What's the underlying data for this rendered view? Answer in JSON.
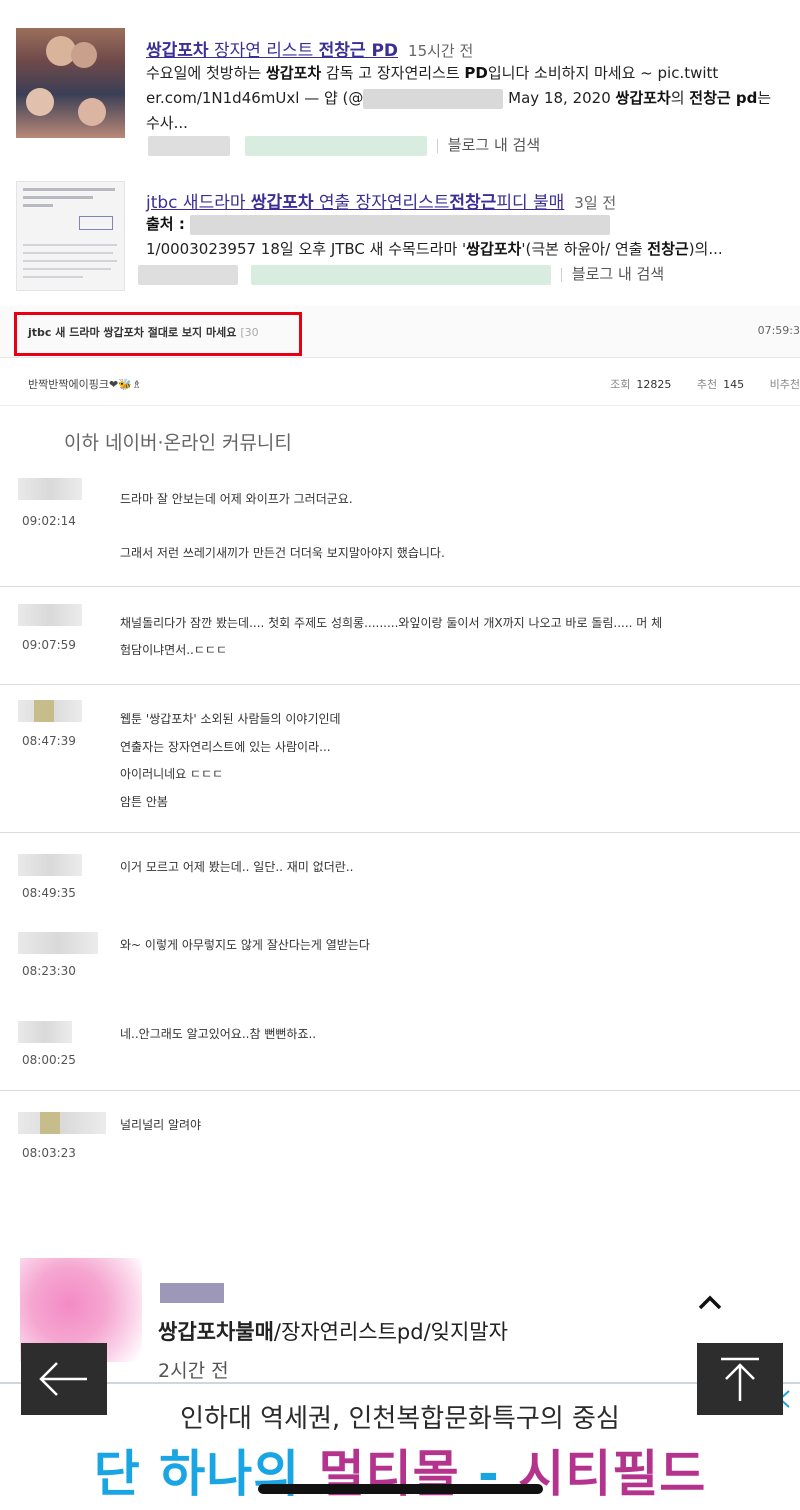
{
  "results": [
    {
      "title_a": "쌍갑포차",
      "title_b": " 장자연 리스트 ",
      "title_c": "전창근 PD",
      "when": "15시간 전",
      "line1_a": "수요일에 첫방하는 ",
      "line1_b": "쌍갑포차",
      "line1_c": " 감독 고 장자연리스트 ",
      "line1_d": "PD",
      "line1_e": "입니다 소비하지 마세요 ~ pic.twitt",
      "line2_a": "er.com/1N1d46mUxl — 얍 (@",
      "line2_b": "May 18, 2020 ",
      "line2_c": "쌍갑포차",
      "line2_d": "의 ",
      "line2_e": "전창근 pd",
      "line2_f": "는",
      "line3": "수사...",
      "footer": "블로그 내 검색"
    },
    {
      "title_a": "jtbc 새드라마 ",
      "title_b": "쌍갑포차",
      "title_c": " 연출 장자연리스트",
      "title_d": "전창근",
      "title_e": "피디 불매",
      "when": "3일 전",
      "line1": "출처 :",
      "line2_a": "1/0003023957 18일 오후 JTBC 새 수목드라마 '",
      "line2_b": "쌍갑포차",
      "line2_c": "'(극본 하윤아/ 연출 ",
      "line2_d": "전창근",
      "line2_e": ")의...",
      "footer": "블로그 내 검색"
    }
  ],
  "post": {
    "title": "jtbc 새 드라마 쌍갑포차 절대로 보지 마세요",
    "title_count": "[30",
    "time": "07:59:3",
    "author": "반짝반짝에이핑크❤🐝♗",
    "views_label": "조회",
    "views": "12825",
    "likes_label": "추천",
    "likes": "145",
    "dislikes_label": "비추천"
  },
  "section_caption": "이하 네이버·온라인 커뮤니티",
  "comments": [
    {
      "time": "09:02:14",
      "lines": [
        "드라마 잘 안보는데 어제 와이프가 그러더군요.",
        "",
        "그래서 저런 쓰레기새끼가 만든건 더더욱 보지말아야지 했습니다."
      ]
    },
    {
      "time": "09:07:59",
      "lines": [
        "채널돌리다가 잠깐 봤는데.... 첫회 주제도 성희롱.........와잎이랑 둘이서 개X까지 나오고 바로 돌림..... 머 체",
        "험담이냐면서..ㄷㄷㄷ"
      ]
    },
    {
      "time": "08:47:39",
      "lines": [
        "웹툰 '쌍갑포차' 소외된 사람들의 이야기인데",
        "연출자는 장자연리스트에 있는 사람이라...",
        "아이러니네요 ㄷㄷㄷ",
        "암튼 안봄"
      ]
    },
    {
      "time": "08:49:35",
      "lines": [
        "이거 모르고 어제 봤는데.. 일단.. 재미 없더란.."
      ]
    },
    {
      "time": "08:23:30",
      "lines": [
        "와~ 이렇게 아무렇지도 않게 잘산다는게 열받는다"
      ]
    },
    {
      "time": "08:00:25",
      "lines": [
        "네..안그래도 알고있어요..참 뻔뻔하죠.."
      ]
    },
    {
      "time": "08:03:23",
      "lines": [
        "널리널리 알려야"
      ]
    }
  ],
  "card": {
    "title_bold": "쌍갑포차불매",
    "title_rest": "/장자연리스트pd/잊지말자",
    "ago": "2시간 전"
  },
  "ad": {
    "line1": "인하대 역세권, 인천복합문화특구의 중심",
    "line2_a": "단 하나의 ",
    "line2_b": "멀티몰",
    "line2_c": " - ",
    "line2_d": "시티필드"
  },
  "colors": {
    "highlight_box": "#e60012",
    "link": "#3b2f97",
    "ad_blue": "#19a4e3",
    "ad_pink": "#b4348d"
  },
  "icons": {
    "back": "arrow-left-icon",
    "top": "arrow-up-icon",
    "collapse": "chevron-up-icon",
    "ad_close": "close-icon"
  }
}
